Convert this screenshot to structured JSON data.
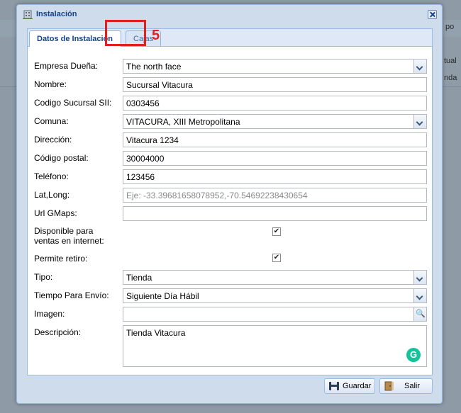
{
  "background": {
    "col_header": "po",
    "row1": "tual",
    "row2": "nda"
  },
  "dialog": {
    "title": "Instalación",
    "tabs": [
      {
        "label": "Datos de Instalación"
      },
      {
        "label": "Cajas"
      }
    ],
    "annotation_number": "5",
    "fields": {
      "empresa": {
        "label": "Empresa Dueña:",
        "value": "The north face"
      },
      "nombre": {
        "label": "Nombre:",
        "value": "Sucursal Vitacura"
      },
      "codigo_sii": {
        "label": "Codigo Sucursal SII:",
        "value": "0303456"
      },
      "comuna": {
        "label": "Comuna:",
        "value": "VITACURA, XIII Metropolitana"
      },
      "direccion": {
        "label": "Dirección:",
        "value": "Vitacura 1234"
      },
      "codigo_postal": {
        "label": "Código postal:",
        "value": "30004000"
      },
      "telefono": {
        "label": "Teléfono:",
        "value": "123456"
      },
      "latlong": {
        "label": "Lat,Long:",
        "placeholder": "Eje: -33.39681658078952,-70.54692238430654"
      },
      "url_gmaps": {
        "label": "Url GMaps:",
        "value": ""
      },
      "disponible": {
        "label": "Disponible para ventas en internet:",
        "checked": true
      },
      "retiro": {
        "label": "Permite retiro:",
        "checked": true
      },
      "tipo": {
        "label": "Tipo:",
        "value": "Tienda"
      },
      "tiempo_envio": {
        "label": "Tiempo Para Envío:",
        "value": "Siguiente Día Hábil"
      },
      "imagen": {
        "label": "Imagen:",
        "value": ""
      },
      "descripcion": {
        "label": "Descripción:",
        "value": "Tienda Vitacura"
      }
    },
    "buttons": {
      "guardar": "Guardar",
      "salir": "Salir"
    }
  },
  "colors": {
    "accent": "#15428b",
    "highlight": "#e02020",
    "grammarly": "#15c39a"
  }
}
